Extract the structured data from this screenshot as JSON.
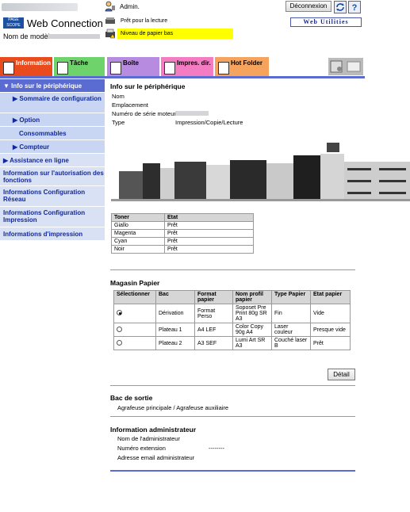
{
  "header": {
    "logo_mark": "PAGE SCOPE",
    "logo_title": "Web Connection",
    "model_label": "Nom de modèle",
    "admin_label": "Admin.",
    "status_ready": "Prêt pour la lecture",
    "status_paper": "Niveau de papier bas",
    "logout_label": "Déconnexion",
    "web_utilities": "Web Utilities"
  },
  "tabs": [
    {
      "label": "Information",
      "color": "#e94b1c",
      "icon": "info-icon"
    },
    {
      "label": "Tâche",
      "color": "#6fd36b",
      "icon": "job-icon"
    },
    {
      "label": "Boîte",
      "color": "#b78be0",
      "icon": "box-icon"
    },
    {
      "label": "Impres. dir.",
      "color": "#f37cc2",
      "icon": "print-icon"
    },
    {
      "label": "Hot Folder",
      "color": "#f6a35d",
      "icon": "folder-icon"
    }
  ],
  "sidebar": {
    "items": [
      {
        "label": "▼ Info sur le périphérique"
      },
      {
        "label": "▶ Sommaire de configuration"
      },
      {
        "label": "▶ Option"
      },
      {
        "label": "Consommables"
      },
      {
        "label": "▶ Compteur"
      },
      {
        "label": "▶ Assistance en ligne"
      },
      {
        "label": "Information sur l'autorisation des fonctions"
      },
      {
        "label": "Informations Configuration Réseau"
      },
      {
        "label": "Informations Configuration Impression"
      },
      {
        "label": "Informations d'impression"
      }
    ]
  },
  "device": {
    "title": "Info sur le périphérique",
    "name_label": "Nom",
    "location_label": "Emplacement",
    "serial_label": "Numéro de série moteur",
    "type_label": "Type",
    "type_value": "Impression/Copie/Lecture"
  },
  "toner": {
    "headers": [
      "Toner",
      "Etat"
    ],
    "rows": [
      [
        "Giallo",
        "Prêt"
      ],
      [
        "Magenta",
        "Prêt"
      ],
      [
        "Cyan",
        "Prêt"
      ],
      [
        "Noir",
        "Prêt"
      ]
    ]
  },
  "paper": {
    "title": "Magasin Papier",
    "headers": [
      "Sélectionner",
      "Bac",
      "Format papier",
      "Nom profil papier",
      "Type Papier",
      "Etat papier"
    ],
    "rows": [
      {
        "selected": true,
        "bac": "Dérivation",
        "format": "Format Perso",
        "profil": "Soposet Pre Print 80g SR A3",
        "type": "Fin",
        "etat": "Vide"
      },
      {
        "selected": false,
        "bac": "Plateau 1",
        "format": "A4 LEF",
        "profil": "Color Copy 90g A4",
        "type": "Laser couleur",
        "etat": "Presque vide"
      },
      {
        "selected": false,
        "bac": "Plateau 2",
        "format": "A3 SEF",
        "profil": "Lumi Art SR A3",
        "type": "Couché laser B",
        "etat": "Prêt"
      }
    ],
    "detail_button": "Détail"
  },
  "output": {
    "title": "Bac de sortie",
    "value": "Agrafeuse principale / Agrafeuse auxiliaire"
  },
  "admin": {
    "title": "Information administrateur",
    "name_label": "Nom de l'administrateur",
    "ext_label": "Numéro extension",
    "ext_value": "--------",
    "email_label": "Adresse email administrateur"
  }
}
